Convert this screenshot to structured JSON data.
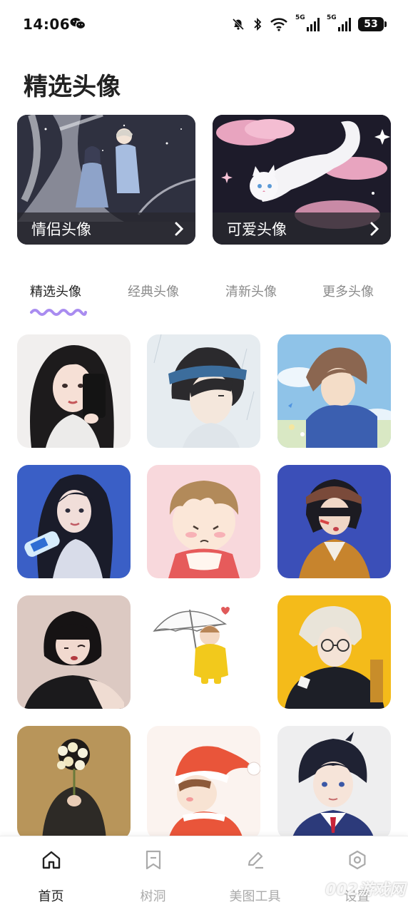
{
  "status": {
    "time": "14:06",
    "signal1_label": "5G",
    "signal2_label": "5G",
    "battery": "53"
  },
  "page": {
    "title": "精选头像"
  },
  "featured": [
    {
      "label": "情侣头像"
    },
    {
      "label": "可爱头像"
    }
  ],
  "tabs": [
    {
      "label": "精选头像",
      "active": true
    },
    {
      "label": "经典头像",
      "active": false
    },
    {
      "label": "清新头像",
      "active": false
    },
    {
      "label": "更多头像",
      "active": false
    }
  ],
  "nav": [
    {
      "label": "首页",
      "icon": "home-icon",
      "active": true
    },
    {
      "label": "树洞",
      "icon": "bookmark-icon",
      "active": false
    },
    {
      "label": "美图工具",
      "icon": "pen-icon",
      "active": false
    },
    {
      "label": "设置",
      "icon": "settings-icon",
      "active": false
    }
  ],
  "watermark": "002游戏网",
  "colors": {
    "accent": "#a98cf0",
    "active_text": "#222222",
    "inactive_text": "#8a8a8a"
  }
}
